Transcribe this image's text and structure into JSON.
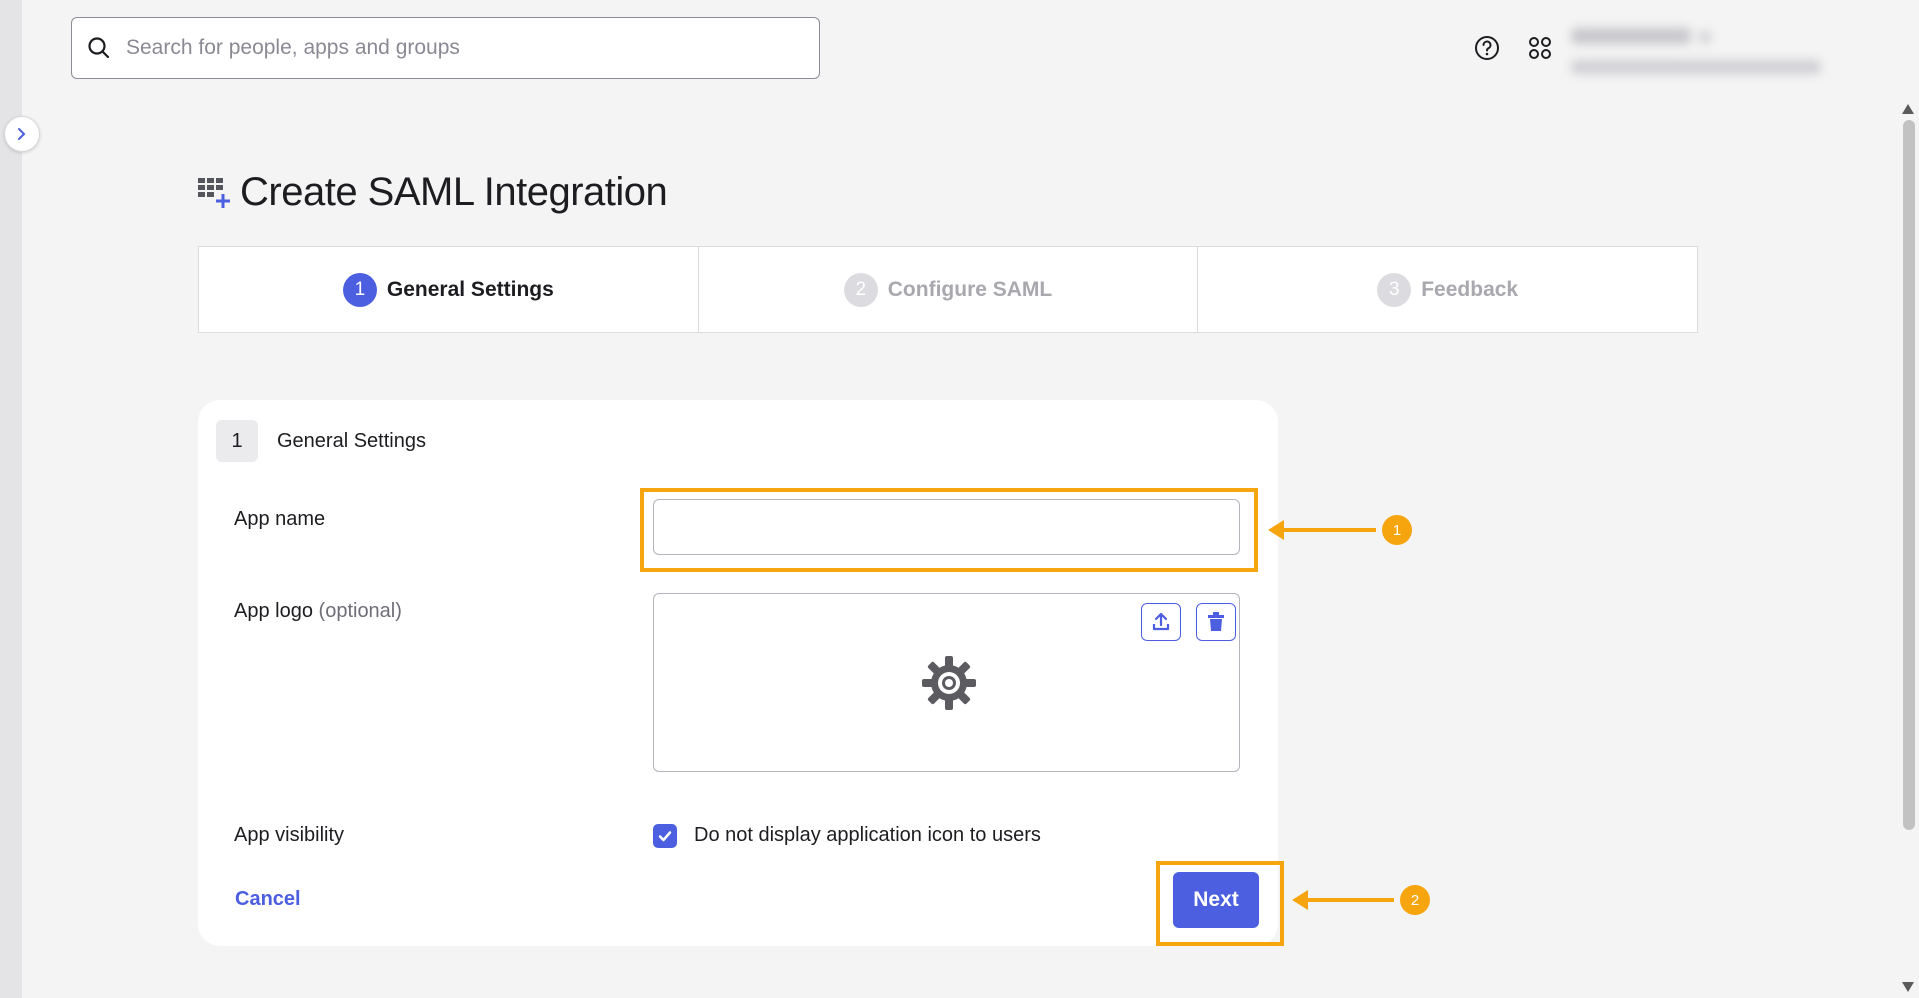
{
  "search": {
    "placeholder": "Search for people, apps and groups"
  },
  "header": {
    "help_icon": "help-circle-icon",
    "apps_icon": "apps-grid-icon"
  },
  "page": {
    "title": "Create SAML Integration"
  },
  "steps": [
    {
      "number": "1",
      "label": "General Settings",
      "state": "active"
    },
    {
      "number": "2",
      "label": "Configure SAML",
      "state": "inactive"
    },
    {
      "number": "3",
      "label": "Feedback",
      "state": "inactive"
    }
  ],
  "form": {
    "section_number": "1",
    "section_title": "General Settings",
    "app_name_label": "App name",
    "app_name_value": "",
    "app_logo_label": "App logo",
    "app_logo_optional": "(optional)",
    "app_visibility_label": "App visibility",
    "visibility_checkbox_label": "Do not display application icon to users",
    "visibility_checked": true,
    "cancel_label": "Cancel",
    "next_label": "Next"
  },
  "annotations": [
    {
      "number": "1",
      "target": "app-name-input"
    },
    {
      "number": "2",
      "target": "next-button"
    }
  ],
  "colors": {
    "accent": "#4b5fe0",
    "highlight": "#f7a50f",
    "background": "#f4f4f4"
  }
}
